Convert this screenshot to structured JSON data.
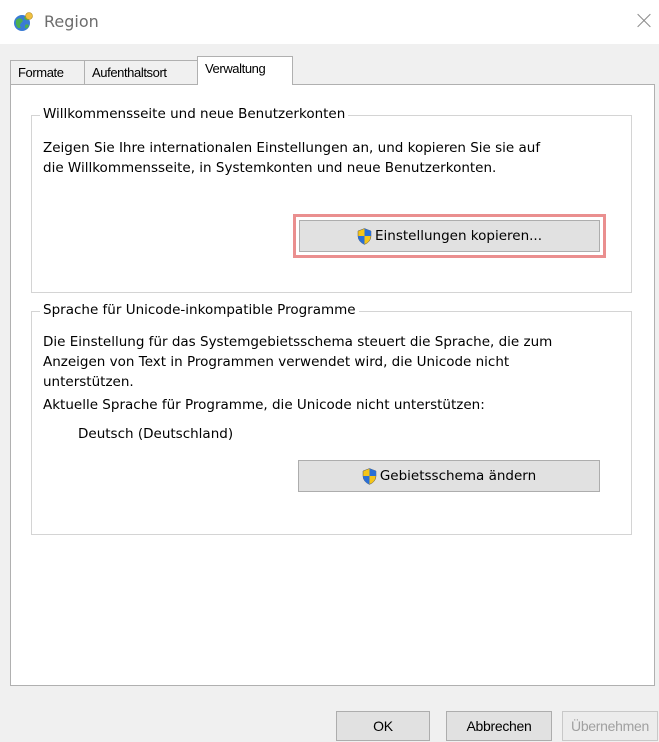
{
  "window": {
    "title": "Region",
    "icon": "globe-region-icon",
    "close_icon": "close-icon"
  },
  "tabs": [
    {
      "label": "Formate",
      "active": false
    },
    {
      "label": "Aufenthaltsort",
      "active": false
    },
    {
      "label": "Verwaltung",
      "active": true
    }
  ],
  "welcome_group": {
    "legend": "Willkommensseite und neue Benutzerkonten",
    "description_line1": "Zeigen Sie Ihre internationalen Einstellungen an, und kopieren Sie sie auf",
    "description_line2": "die Willkommensseite, in Systemkonten und neue Benutzerkonten.",
    "copy_button_label": "Einstellungen kopieren...",
    "copy_button_icon": "uac-shield-icon",
    "highlight_color": "#ea8f8f"
  },
  "unicode_group": {
    "legend": "Sprache für Unicode-inkompatible Programme",
    "description_line1": "Die Einstellung für das Systemgebietsschema steuert die Sprache, die zum",
    "description_line2": "Anzeigen von Text in Programmen verwendet wird, die Unicode nicht",
    "description_line3": "unterstützen.",
    "current_label": "Aktuelle Sprache für Programme, die Unicode nicht unterstützen:",
    "current_value": "Deutsch (Deutschland)",
    "change_button_label": "Gebietsschema ändern",
    "change_button_icon": "uac-shield-icon"
  },
  "footer": {
    "ok_label": "OK",
    "cancel_label": "Abbrechen",
    "apply_label": "Übernehmen",
    "apply_enabled": false
  }
}
